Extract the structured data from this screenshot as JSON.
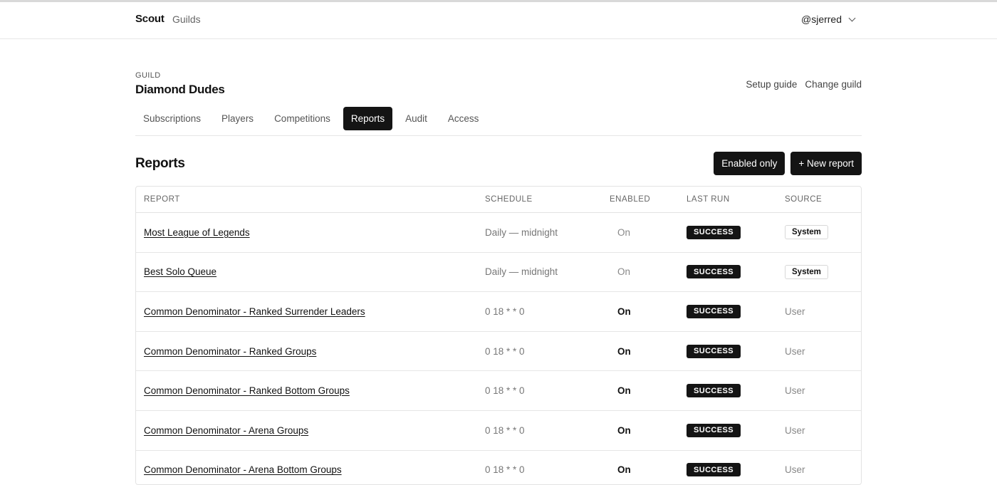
{
  "navbar": {
    "brand": "Scout",
    "links": [
      "Guilds"
    ],
    "user": "@sjerred"
  },
  "guild": {
    "eyebrow": "GUILD",
    "name": "Diamond Dudes",
    "links": [
      "Setup guide",
      "Change guild"
    ]
  },
  "tabs": [
    {
      "label": "Subscriptions",
      "active": false
    },
    {
      "label": "Players",
      "active": false
    },
    {
      "label": "Competitions",
      "active": false
    },
    {
      "label": "Reports",
      "active": true
    },
    {
      "label": "Audit",
      "active": false
    },
    {
      "label": "Access",
      "active": false
    }
  ],
  "section": {
    "title": "Reports",
    "enabled_only_label": "Enabled only",
    "new_report_label": "+ New report"
  },
  "table": {
    "columns": [
      "REPORT",
      "SCHEDULE",
      "ENABLED",
      "LAST RUN",
      "SOURCE"
    ],
    "rows": [
      {
        "report": "Most League of Legends",
        "schedule": "Daily — midnight",
        "enabled": "On",
        "last_run": "SUCCESS",
        "source": "System"
      },
      {
        "report": "Best Solo Queue",
        "schedule": "Daily — midnight",
        "enabled": "On",
        "last_run": "SUCCESS",
        "source": "System"
      },
      {
        "report": "Common Denominator - Ranked Surrender Leaders",
        "schedule": "0 18 * * 0",
        "enabled": "On",
        "last_run": "SUCCESS",
        "source": "User"
      },
      {
        "report": "Common Denominator - Ranked Groups",
        "schedule": "0 18 * * 0",
        "enabled": "On",
        "last_run": "SUCCESS",
        "source": "User"
      },
      {
        "report": "Common Denominator - Ranked Bottom Groups",
        "schedule": "0 18 * * 0",
        "enabled": "On",
        "last_run": "SUCCESS",
        "source": "User"
      },
      {
        "report": "Common Denominator - Arena Groups",
        "schedule": "0 18 * * 0",
        "enabled": "On",
        "last_run": "SUCCESS",
        "source": "User"
      },
      {
        "report": "Common Denominator - Arena Bottom Groups",
        "schedule": "0 18 * * 0",
        "enabled": "On",
        "last_run": "SUCCESS",
        "source": "User"
      }
    ]
  }
}
